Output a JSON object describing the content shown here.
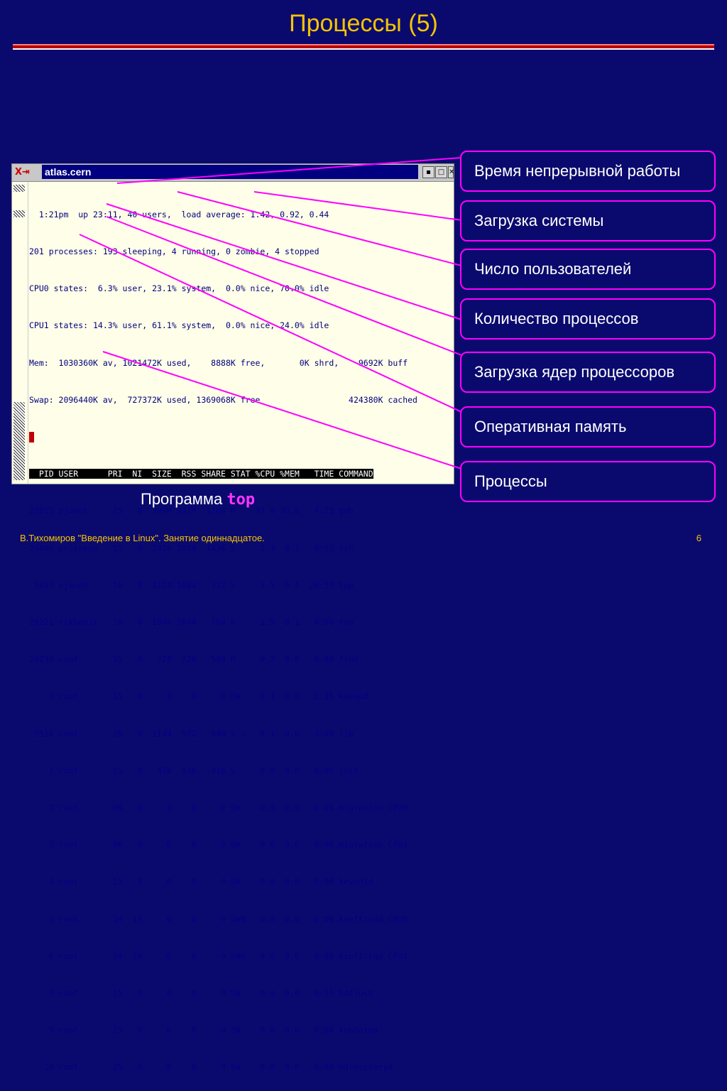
{
  "slide": {
    "title": "Процессы (5)",
    "caption_text": "Программа",
    "caption_cmd": "top",
    "footer": "В.Тихомиров \"Введение в Linux\". Занятие одиннадцатое.",
    "page": "6"
  },
  "window": {
    "title": "atlas.cern",
    "buttons": {
      "minimize": "▪",
      "maximize": "□",
      "close": "✕"
    }
  },
  "terminal": {
    "summary": [
      "  1:21pm  up 23:11, 40 users,  load average: 1.42, 0.92, 0.44",
      "201 processes: 193 sleeping, 4 running, 0 zombie, 4 stopped",
      "CPU0 states:  6.3% user, 23.1% system,  0.0% nice, 70.0% idle",
      "CPU1 states: 14.3% user, 61.1% system,  0.0% nice, 24.0% idle",
      "Mem:  1030360K av, 1021472K used,    8888K free,       0K shrd,    9692K buff",
      "Swap: 2096440K av,  727372K used, 1369068K free                  424380K cached"
    ],
    "header": "  PID USER      PRI  NI  SIZE  RSS SHARE STAT %CPU %MEM   TIME COMMAND",
    "rows": [
      "27815 pjanot     25   0  399M 397M  1764 R    97.9 38.5   4:25 gdb",
      "23406 poliakov   15   0  2028 2028  1436 S     2.3  0.1   0:53 ssh",
      " 5457 pjanot     16   0  1124 1084   772 S     1.5  0.1  26:26 top",
      "28221 tikhomir   16   0  1044 1044   764 R     1.5  0.1   0:00 top",
      "28230 root       15   0   728  728   584 R     0.7  0.0   0:00 find",
      "    7 root       15   0     0    0     0 SW    0.1  0.0   1:35 kswapd",
      " 1516 root       20   0  1144  972   840 S <   0.1  0.0   3:49 lim",
      "    1 root       15   0   476  436   416 S     0.0  0.0   0:05 init",
      "    2 root       0K   0     0    0     0 SW    0.0  0.0   0:00 migration_CPU0",
      "    3 root       0K   0     0    0     0 SW    0.0  0.0   0:00 migration_CPU1",
      "    4 root       15   0     0    0     0 SW    0.0  0.0   0:00 keventd",
      "    5 root       34  19     0    0     0 SWN   0.0  0.0   0:00 ksoftirqd_CPU0",
      "    6 root       34  19     0    0     0 SWN   0.0  0.0   0:00 ksoftirqd_CPU1",
      "    8 root       15   0     0    0     0 SW    0.0  0.0   0:15 bdflush",
      "    9 root       15   0     0    0     0 SW    0.0  0.0   0:04 kupdated",
      "   10 root       25   0     0    0     0 SW    0.0  0.0   0:00 mdrecoveryd"
    ]
  },
  "callouts": [
    "Время непрерывной работы",
    "Загрузка системы",
    "Число пользователей",
    "Количество процессов",
    "Загрузка ядер процессоров",
    "Оперативная память",
    "Процессы"
  ],
  "colors": {
    "background": "#0a0a6e",
    "title": "#f5c400",
    "callout_border": "#ff00ff",
    "terminal_text": "#000080"
  }
}
